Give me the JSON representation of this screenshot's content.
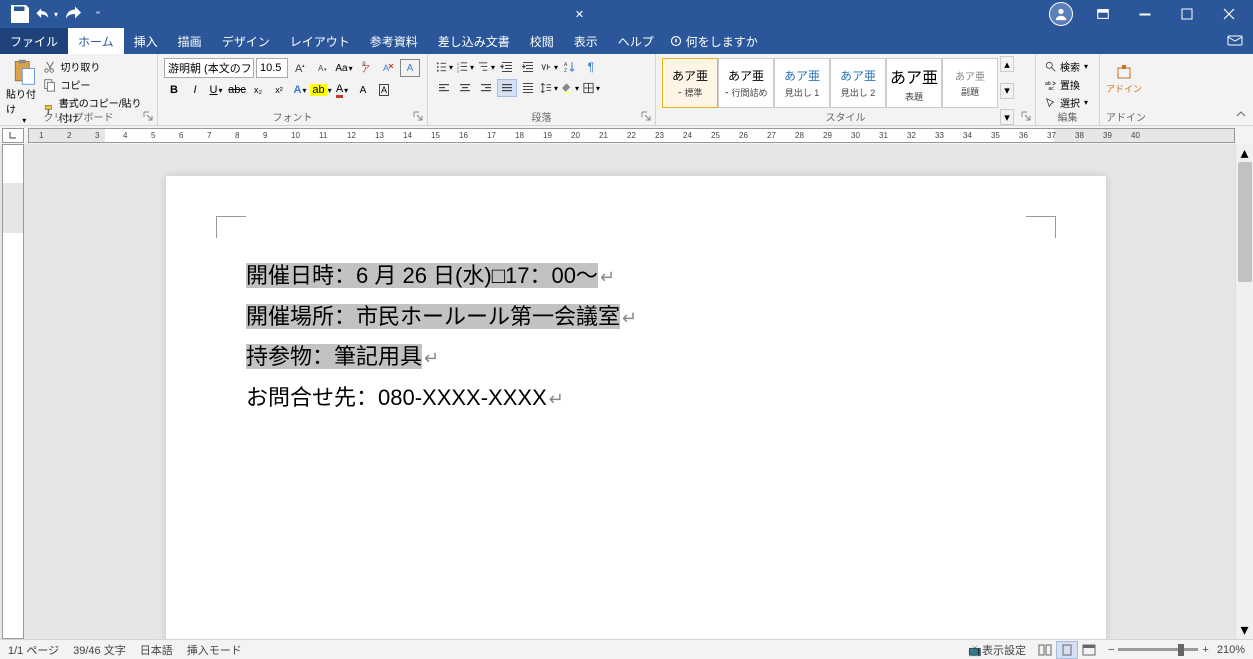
{
  "titlebar": {
    "doc_indicator": "✕"
  },
  "tabs": {
    "file": "ファイル",
    "home": "ホーム",
    "insert": "挿入",
    "draw": "描画",
    "design": "デザイン",
    "layout": "レイアウト",
    "references": "参考資料",
    "mailings": "差し込み文書",
    "review": "校閲",
    "view": "表示",
    "help": "ヘルプ",
    "tellme": "何をしますか"
  },
  "clipboard": {
    "group": "クリップボード",
    "paste": "貼り付け",
    "cut": "切り取り",
    "copy": "コピー",
    "format_painter": "書式のコピー/貼り付け"
  },
  "font": {
    "group": "フォント",
    "name": "游明朝 (本文のフォン",
    "size": "10.5"
  },
  "paragraph": {
    "group": "段落"
  },
  "styles": {
    "group": "スタイル",
    "items": [
      {
        "preview": "あア亜",
        "label": "⁃ 標準"
      },
      {
        "preview": "あア亜",
        "label": "⁃ 行間詰め"
      },
      {
        "preview": "あア亜",
        "label": "見出し 1"
      },
      {
        "preview": "あア亜",
        "label": "見出し 2"
      },
      {
        "preview": "あア亜",
        "label": "表題"
      },
      {
        "preview": "あア亜",
        "label": "副題"
      }
    ]
  },
  "editing": {
    "group": "編集",
    "find": "検索",
    "replace": "置換",
    "select": "選択"
  },
  "addins": {
    "group": "アドイン",
    "label": "アドイン"
  },
  "document": {
    "lines": [
      {
        "text": "開催日時：6 月 26 日(水)□17：00～",
        "selected": true
      },
      {
        "text": "開催場所：市民ホールール第一会議室",
        "selected": true
      },
      {
        "text": "持参物：筆記用具",
        "selected": true
      },
      {
        "text": "お問合せ先：080-XXXX-XXXX",
        "selected": false
      }
    ]
  },
  "statusbar": {
    "page": "1/1 ページ",
    "words": "39/46 文字",
    "lang": "日本語",
    "mode": "挿入モード",
    "display": "表示設定",
    "zoom": "210%"
  },
  "ruler": {
    "visible": [
      "3",
      "1",
      "2",
      "3",
      "4",
      "5",
      "6",
      "7",
      "8",
      "9",
      "10",
      "11",
      "12",
      "13",
      "14",
      "15",
      "16",
      "17",
      "18",
      "19",
      "20",
      "21",
      "22",
      "23",
      "24",
      "25",
      "26",
      "27",
      "28",
      "29",
      "30",
      "31",
      "34",
      "35",
      "36"
    ]
  }
}
